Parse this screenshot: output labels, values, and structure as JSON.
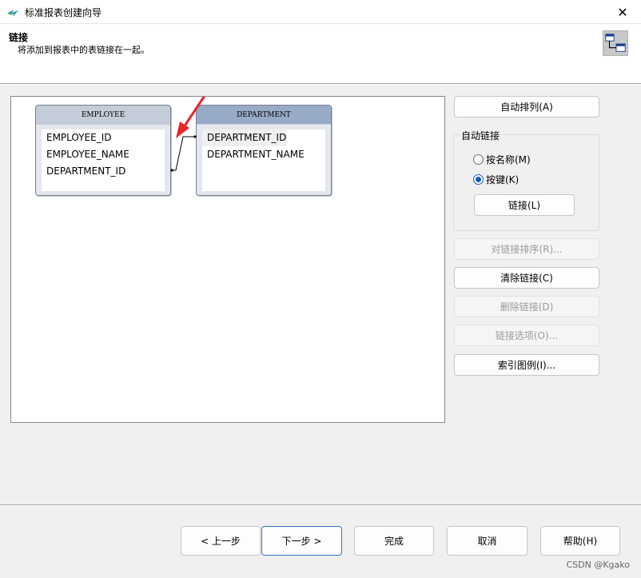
{
  "window": {
    "title": "标准报表创建向导",
    "close_label": "✕"
  },
  "header": {
    "title": "链接",
    "subtitle": "将添加到报表中的表链接在一起。"
  },
  "tables": [
    {
      "name": "EMPLOYEE",
      "fields": [
        "EMPLOYEE_ID",
        "EMPLOYEE_NAME",
        "DEPARTMENT_ID"
      ]
    },
    {
      "name": "DEPARTMENT",
      "fields": [
        "DEPARTMENT_ID",
        "DEPARTMENT_NAME"
      ]
    }
  ],
  "links": [
    {
      "from": "EMPLOYEE.DEPARTMENT_ID",
      "to": "DEPARTMENT.DEPARTMENT_ID"
    }
  ],
  "buttons": {
    "auto_arrange": "自动排列(A)",
    "link": "链接(L)",
    "order_links": "对链接排序(R)...",
    "clear_links": "清除链接(C)",
    "delete_link": "删除链接(D)",
    "link_options": "链接选项(O)...",
    "index_legend": "索引图例(I)..."
  },
  "auto_link": {
    "legend": "自动链接",
    "options": [
      {
        "label": "按名称(M)",
        "checked": false
      },
      {
        "label": "按键(K)",
        "checked": true
      }
    ]
  },
  "footer": {
    "back": "< 上一步",
    "next": "下一步 >",
    "finish": "完成",
    "cancel": "取消",
    "help": "帮助(H)"
  },
  "watermark": "CSDN @Kgako",
  "colors": {
    "annotation_arrow": "#e8262b",
    "selection_accent": "#0f5cbc"
  }
}
